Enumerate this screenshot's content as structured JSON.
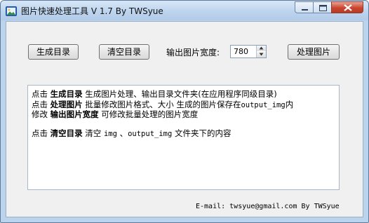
{
  "window": {
    "title": "图片快速处理工具 V 1.7 By TWSyue",
    "icon": "picture-icon"
  },
  "buttons": {
    "generate": "生成目录",
    "clear": "清空目录",
    "process": "处理图片"
  },
  "width_setting": {
    "label": "输出图片宽度:",
    "value": "780"
  },
  "help": {
    "line1": {
      "prefix": "点击 ",
      "keyword": "生成目录",
      "desc": " 生成图片处理、输出目录文件夹(在应用程序同级目录)"
    },
    "line2": {
      "prefix": "点击 ",
      "keyword": "处理图片",
      "desc": " 批量修改图片格式、大小        生成的图片保存在",
      "mono": "output_img",
      "suffix": "内"
    },
    "line3": {
      "prefix": "修改 ",
      "keyword": "输出图片宽度",
      "desc": " 可修改批量处理的图片宽度"
    },
    "line4": {
      "prefix": "点击 ",
      "keyword": "清空目录",
      "desc1": " 清空 ",
      "mono1": "img",
      "sep": " 、",
      "mono2": "output_img",
      "desc2": " 文件夹下的内容"
    }
  },
  "footer": "E-mail: twsyue@gmail.com By TWSyue"
}
